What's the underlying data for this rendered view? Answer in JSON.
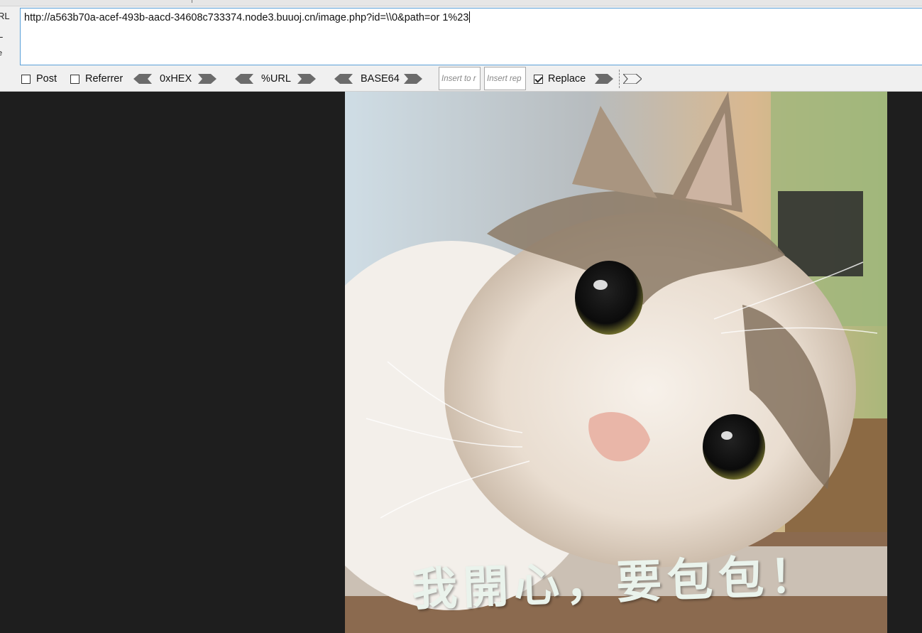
{
  "hackbar": {
    "side_labels": [
      "RL",
      "L",
      "e"
    ],
    "url": "http://a563b70a-acef-493b-aacd-34608c733374.node3.buuoj.cn/image.php?id=\\\\0&path=or 1%23",
    "toolbar": {
      "post": {
        "label": "Post",
        "checked": false
      },
      "referrer": {
        "label": "Referrer",
        "checked": false
      },
      "hex_label": "0xHEX",
      "url_label": "%URL",
      "base64_label": "BASE64",
      "insert_to_placeholder": "Insert to r",
      "insert_replace_placeholder": "Insert rep",
      "replace": {
        "label": "Replace",
        "checked": true
      }
    }
  },
  "image": {
    "subject": "cat photo",
    "caption": "我開心，要包包！"
  }
}
